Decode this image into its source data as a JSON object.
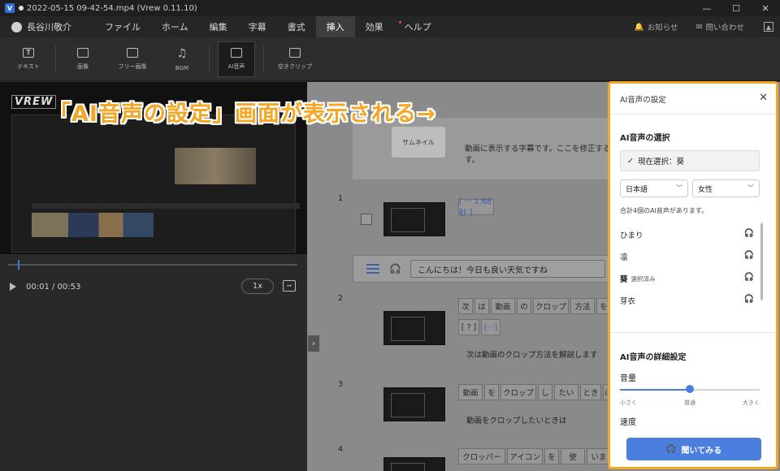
{
  "titlebar": {
    "title": "2022-05-15 09-42-54.mp4 (Vrew 0.11.10)",
    "logo": "V",
    "controls": [
      "—",
      "☐",
      "✕"
    ]
  },
  "menubar": {
    "user": "長谷川敬介",
    "items": [
      "ファイル",
      "ホーム",
      "編集",
      "字幕",
      "書式",
      "挿入",
      "効果",
      "ヘルプ"
    ],
    "active": "挿入",
    "notify": "お知らせ",
    "contact": "問い合わせ"
  },
  "ribbon": {
    "tools": [
      {
        "label": "テキスト",
        "icon": "T"
      },
      {
        "label": "画像",
        "icon": "▣"
      },
      {
        "label": "フリー画像",
        "icon": "▣"
      },
      {
        "label": "BGM",
        "icon": "♫"
      },
      {
        "label": "AI音声",
        "icon": "◍"
      },
      {
        "label": "空きクリップ",
        "icon": ""
      }
    ]
  },
  "preview": {
    "watermark": "VREW",
    "time": "00:01 / 00:53",
    "speed": "1x"
  },
  "editor": {
    "thumbnail_button": "サムネイル",
    "card_text": "動画に表示する字幕です。ここを修正する",
    "card_text_2": "す。",
    "rows": [
      {
        "num": "1",
        "tags": [
          "[ ··· 1.68秒 ]"
        ]
      },
      {
        "num": "2",
        "tags": [
          "次",
          "は",
          "動画",
          "の",
          "クロップ",
          "方法",
          "を",
          "[ ? ]",
          "[···]"
        ],
        "sentence": "次は動画のクロップ方法を解説します"
      },
      {
        "num": "3",
        "tags": [
          "動画",
          "を",
          "クロップ",
          "し",
          "たい",
          "とき",
          "は"
        ],
        "sentence": "動画をクロップしたいときは"
      },
      {
        "num": "4",
        "tags": [
          "クロッパー",
          "アイコン",
          "を",
          "使",
          "いま"
        ]
      }
    ],
    "voice_input": "こんにちは！今日も良い天気ですね"
  },
  "annotation": "「AI音声の設定」画面が表示される→",
  "panel": {
    "title": "AI音声の設定",
    "select_title": "AI音声の選択",
    "current": "現在選択：葵",
    "language": "日本語",
    "gender": "女性",
    "count": "合計4個のAI音声があります。",
    "voices": [
      {
        "name": "ひまり",
        "tag": ""
      },
      {
        "name": "凛",
        "tag": ""
      },
      {
        "name": "葵",
        "tag": "選択済み"
      },
      {
        "name": "芽衣",
        "tag": ""
      }
    ],
    "detail_title": "AI音声の詳細設定",
    "volume_label": "音量",
    "volume_level": 0.5,
    "ticks": [
      "小さく",
      "普通",
      "大きく"
    ],
    "speed_label": "速度",
    "listen_button": "聞いてみる"
  }
}
